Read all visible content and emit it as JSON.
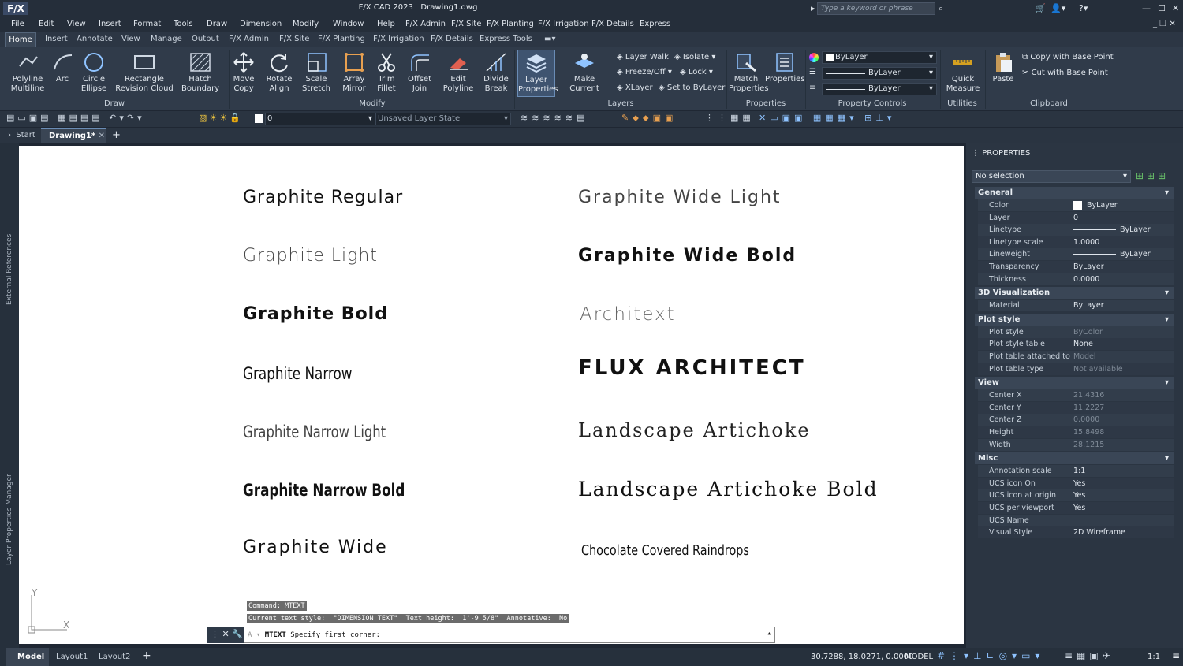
{
  "title": {
    "logo": "F/X",
    "app": "F/X CAD 2023",
    "doc": "Drawing1.dwg",
    "search_placeholder": "Type a keyword or phrase"
  },
  "menu": [
    "File",
    "Edit",
    "View",
    "Insert",
    "Format",
    "Tools",
    "Draw",
    "Dimension",
    "Modify",
    "Window",
    "Help",
    "F/X Admin",
    "F/X Site",
    "F/X Planting",
    "F/X Irrigation",
    "F/X Details",
    "Express"
  ],
  "ribbon_tabs": [
    "Home",
    "Insert",
    "Annotate",
    "View",
    "Manage",
    "Output",
    "F/X Admin",
    "F/X Site",
    "F/X Planting",
    "F/X Irrigation",
    "F/X Details",
    "Express Tools"
  ],
  "ribbon": {
    "draw": {
      "title": "Draw",
      "polyline": "Polyline",
      "multiline": "Multiline",
      "arc": "Arc",
      "circle": "Circle",
      "ellipse": "Ellipse",
      "rectangle": "Rectangle",
      "revision_cloud": "Revision Cloud",
      "hatch": "Hatch",
      "boundary": "Boundary"
    },
    "modify": {
      "title": "Modify",
      "move": "Move",
      "copy": "Copy",
      "rotate": "Rotate",
      "align": "Align",
      "scale": "Scale",
      "stretch": "Stretch",
      "array": "Array",
      "mirror": "Mirror",
      "trim": "Trim",
      "fillet": "Fillet",
      "offset": "Offset",
      "join": "Join",
      "edit": "Edit",
      "polyline": "Polyline",
      "divide": "Divide",
      "break": "Break"
    },
    "layers": {
      "title": "Layers",
      "layer": "Layer",
      "properties": "Properties",
      "make_current": "Make Current",
      "layer_walk": "Layer Walk",
      "isolate": "Isolate",
      "freeze_off": "Freeze/Off",
      "lock": "Lock",
      "xlayer": "XLayer",
      "set_to_bylayer": "Set to ByLayer"
    },
    "properties": {
      "title": "Properties",
      "match": "Match",
      "match2": "Properties",
      "properties": "Properties"
    },
    "property_controls": {
      "title": "Property Controls",
      "color": "ByLayer",
      "linetype": "ByLayer",
      "lineweight": "ByLayer"
    },
    "utilities": {
      "title": "Utilities",
      "quick": "Quick",
      "measure": "Measure"
    },
    "clipboard": {
      "title": "Clipboard",
      "paste": "Paste",
      "copy_base": "Copy with Base Point",
      "cut_base": "Cut with Base Point"
    }
  },
  "toolbar": {
    "layer_value": "0",
    "layer_state": "Unsaved Layer State"
  },
  "doc_tabs": {
    "start": "Start",
    "drawing": "Drawing1*"
  },
  "side_labels": {
    "xref": "External References",
    "layer_mgr": "Layer Properties Manager"
  },
  "fonts_left": [
    "Graphite Regular",
    "Graphite Light",
    "Graphite Bold",
    "Graphite Narrow",
    "Graphite Narrow Light",
    "Graphite Narrow Bold",
    "Graphite Wide"
  ],
  "fonts_right": [
    "Graphite Wide Light",
    "Graphite Wide Bold",
    "Architext",
    "FLUX ARCHITECT",
    "Landscape Artichoke",
    "Landscape Artichoke Bold",
    "Chocolate Covered Raindrops"
  ],
  "ucs": {
    "x": "X",
    "y": "Y"
  },
  "command": {
    "line1": "Command: MTEXT",
    "line2": "Current text style:  \"DIMENSION TEXT\"  Text height:  1'-9 5/8\"  Annotative:  No",
    "prompt_cmd": "MTEXT",
    "prompt_text": "Specify first corner:"
  },
  "properties_panel": {
    "title": "PROPERTIES",
    "selection": "No selection",
    "general": {
      "title": "General",
      "rows": [
        [
          "Color",
          "ByLayer"
        ],
        [
          "Layer",
          "0"
        ],
        [
          "Linetype",
          "ByLayer"
        ],
        [
          "Linetype scale",
          "1.0000"
        ],
        [
          "Lineweight",
          "ByLayer"
        ],
        [
          "Transparency",
          "ByLayer"
        ],
        [
          "Thickness",
          "0.0000"
        ]
      ]
    },
    "viz": {
      "title": "3D Visualization",
      "rows": [
        [
          "Material",
          "ByLayer"
        ]
      ]
    },
    "plot": {
      "title": "Plot style",
      "rows": [
        [
          "Plot style",
          "ByColor"
        ],
        [
          "Plot style table",
          "None"
        ],
        [
          "Plot table attached to",
          "Model"
        ],
        [
          "Plot table type",
          "Not available"
        ]
      ]
    },
    "view": {
      "title": "View",
      "rows": [
        [
          "Center X",
          "21.4316"
        ],
        [
          "Center Y",
          "11.2227"
        ],
        [
          "Center Z",
          "0.0000"
        ],
        [
          "Height",
          "15.8498"
        ],
        [
          "Width",
          "28.1215"
        ]
      ]
    },
    "misc": {
      "title": "Misc",
      "rows": [
        [
          "Annotation scale",
          "1:1"
        ],
        [
          "UCS icon On",
          "Yes"
        ],
        [
          "UCS icon at origin",
          "Yes"
        ],
        [
          "UCS per viewport",
          "Yes"
        ],
        [
          "UCS Name",
          ""
        ],
        [
          "Visual Style",
          "2D Wireframe"
        ]
      ]
    }
  },
  "status": {
    "model_tab": "Model",
    "layout1": "Layout1",
    "layout2": "Layout2",
    "coords": "30.7288, 18.0271, 0.0000",
    "model": "MODEL",
    "scale": "1:1"
  }
}
